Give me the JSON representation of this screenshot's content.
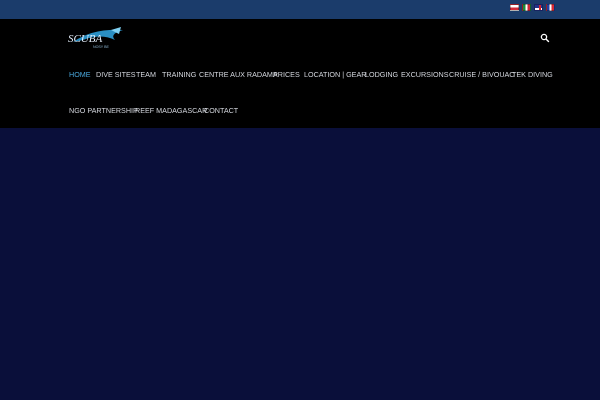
{
  "colors": {
    "topbar": "#1b3c6b",
    "header": "#000000",
    "main": "#0a0f3a",
    "nav_text": "#d6d9e0",
    "nav_active": "#4aa8dd"
  },
  "language_flags": [
    "flag-pl-icon",
    "flag-it-icon",
    "flag-uk-icon",
    "flag-fr-icon"
  ],
  "logo": {
    "text": "SCUBA",
    "subtext": "NOSY BE"
  },
  "nav": {
    "items": [
      {
        "label": "HOME",
        "active": true
      },
      {
        "label": "DIVE SITES"
      },
      {
        "label": "TEAM"
      },
      {
        "label": "TRAINING"
      },
      {
        "label": "CENTRE AUX RADAMA"
      },
      {
        "label": "PRICES"
      },
      {
        "label": "LOCATION | GEAR"
      },
      {
        "label": "LODGING"
      },
      {
        "label": "EXCURSIONS"
      },
      {
        "label": "CRUISE / BIVOUAC"
      },
      {
        "label": "TEK DIVING"
      },
      {
        "label": "NGO PARTNERSHIP"
      },
      {
        "label": "REEF MADAGASCAR"
      },
      {
        "label": "CONTACT"
      }
    ]
  },
  "search": {
    "icon": "search-icon"
  }
}
